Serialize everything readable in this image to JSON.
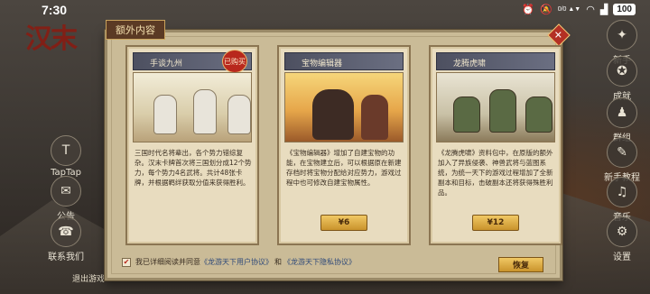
{
  "status_bar": {
    "time": "7:30",
    "battery": "100",
    "network": "0/0 ▲▼",
    "icons": [
      "alarm-icon",
      "mute-icon",
      "wifi-icon",
      "signal-icon"
    ]
  },
  "logo_text": "汉末",
  "left_menu": [
    {
      "label": "TapTap",
      "icon": "tap-icon"
    },
    {
      "label": "公告",
      "icon": "notice-icon"
    },
    {
      "label": "联系我们",
      "icon": "contact-icon"
    },
    {
      "label": "退出游戏",
      "icon": "exit-icon"
    }
  ],
  "right_menu": [
    {
      "label": "新手",
      "icon": "novice-icon"
    },
    {
      "label": "成就",
      "icon": "achievement-icon"
    },
    {
      "label": "群组",
      "icon": "group-icon"
    },
    {
      "label": "新手教程",
      "icon": "tutorial-icon"
    },
    {
      "label": "音乐",
      "icon": "music-icon"
    },
    {
      "label": "设置",
      "icon": "settings-icon"
    }
  ],
  "modal": {
    "title": "额外内容",
    "close": "✕",
    "cards": [
      {
        "name": "手谈九州",
        "owned_badge": "已购买",
        "description": "三国时代名将辈出，各个势力错综复杂。汉末卡牌首次将三国划分成12个势力，每个势力4名武将。共计48张卡牌，并根据羁绊获取分值来获得胜利。",
        "price": ""
      },
      {
        "name": "宝物编辑器",
        "owned_badge": "",
        "description": "《宝物编辑器》增加了自建宝物的功能，在宝物建立后，可以根据原在新建存档时将宝物分配给对应势力，游戏过程中也可修改自建宝物属性。",
        "price": "¥6"
      },
      {
        "name": "龙腾虎啸",
        "owned_badge": "",
        "description": "《龙腾虎啸》资料包中，在原版的额外加入了异族侵袭、神兽武将与蓝图系统，为统一天下的游戏过程增加了全新副本和目标，击破副本还将获得殊胜利品。",
        "price": "¥12"
      }
    ],
    "agreement": {
      "checkbox": "✔",
      "prefix": "我已详细阅读并同意",
      "user_agreement": "《龙游天下用户协议》",
      "and": "和",
      "privacy_agreement": "《龙游天下隐私协议》"
    },
    "restore_label": "恢复"
  }
}
